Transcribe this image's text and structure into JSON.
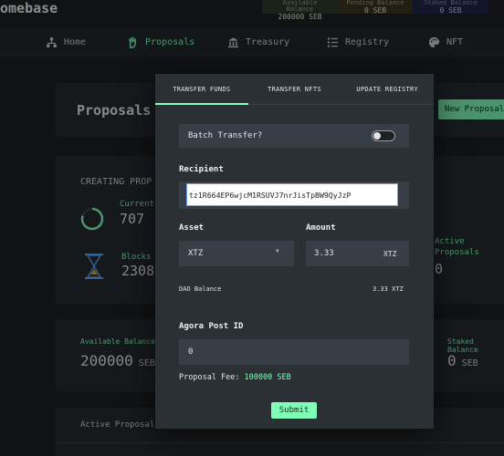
{
  "app": {
    "brand": "omebase"
  },
  "balances": {
    "available": {
      "label": "Available Balance",
      "value": "200000 SEB"
    },
    "pending": {
      "label": "Pending Balance",
      "value": "0 SEB"
    },
    "staked": {
      "label": "Staked Balance",
      "value": "0 SEB"
    }
  },
  "nav": {
    "items": [
      {
        "label": "Home",
        "icon": "home-icon"
      },
      {
        "label": "Proposals",
        "icon": "hand-icon"
      },
      {
        "label": "Treasury",
        "icon": "bank-icon"
      },
      {
        "label": "Registry",
        "icon": "list-icon"
      },
      {
        "label": "NFT",
        "icon": "palette-icon"
      }
    ]
  },
  "page": {
    "title": "Proposals",
    "new_proposal_button": "New Proposal",
    "creating_heading": "CREATING PROP",
    "current_label": "Current",
    "current_value": "707",
    "blocks_label": "Blocks",
    "blocks_value": "2308",
    "active_label_line1": "Active",
    "active_label_line2": "Proposals",
    "active_value": "0",
    "available_balance_label": "Available Balance",
    "available_balance_value": "200000",
    "available_balance_unit": "SEB",
    "staked_label": "Staked Balance",
    "staked_value": "0",
    "staked_unit": "SEB",
    "active_proposals_heading": "Active Proposal"
  },
  "modal": {
    "tabs": [
      "TRANSFER FUNDS",
      "TRANSFER NFTS",
      "UPDATE REGISTRY"
    ],
    "batch_transfer_label": "Batch Transfer?",
    "recipient_label": "Recipient",
    "recipient_value": "tz1R664EP6wjcM1RSUVJ7nrJisTpBW9QyJzP",
    "asset_label": "Asset",
    "asset_value": "XTZ",
    "amount_label": "Amount",
    "amount_value": "3.33",
    "amount_unit": "XTZ",
    "dao_balance_label": "DAO Balance",
    "dao_balance_value": "3.33 XTZ",
    "agora_label": "Agora Post ID",
    "agora_value": "0",
    "proposal_fee_label": "Proposal Fee:",
    "proposal_fee_value": "100000 SEB",
    "submit_label": "Submit"
  },
  "colors": {
    "accent": "#81feb7",
    "background": "#1c2024",
    "panel": "#272c31"
  }
}
